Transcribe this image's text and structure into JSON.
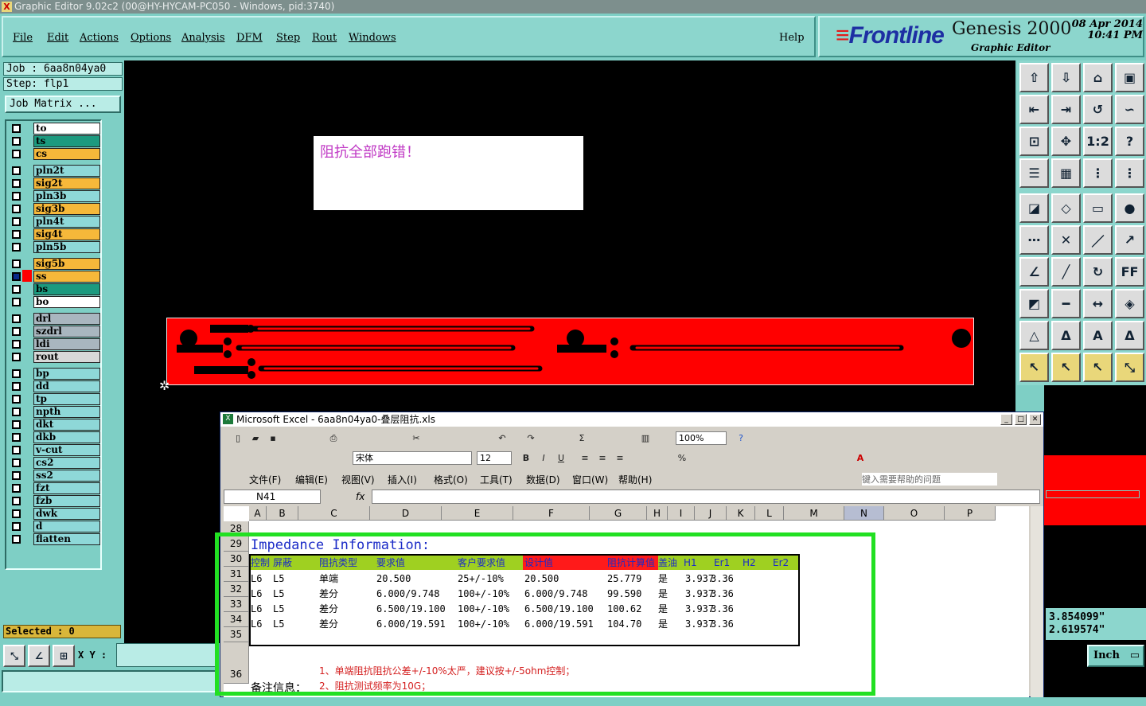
{
  "window": {
    "title": "Graphic Editor 9.02c2 (00@HY-HYCAM-PC050 - Windows, pid:3740)"
  },
  "menu": [
    "File",
    "Edit",
    "Actions",
    "Options",
    "Analysis",
    "DFM",
    "Step",
    "Rout",
    "Windows"
  ],
  "help": "Help",
  "brand": {
    "logo_prefix": "≡",
    "logo": "Frontline",
    "product": "Genesis 2000",
    "subtitle": "Graphic Editor",
    "date": "08 Apr 2014",
    "time": "10:41 PM"
  },
  "job": {
    "job": "Job : 6aa8n04ya0",
    "step": "Step: flp1",
    "matrix_button": "Job Matrix ..."
  },
  "layers": [
    {
      "name": "to",
      "color": "#ffffff"
    },
    {
      "name": "ts",
      "color": "#1c9a7f"
    },
    {
      "name": "cs",
      "color": "#f6b83a"
    },
    {
      "name": "pln2t",
      "color": "#8ed8d8"
    },
    {
      "name": "sig2t",
      "color": "#f6b83a"
    },
    {
      "name": "pln3b",
      "color": "#8ed8d8"
    },
    {
      "name": "sig3b",
      "color": "#f6b83a"
    },
    {
      "name": "pln4t",
      "color": "#8ed8d8"
    },
    {
      "name": "sig4t",
      "color": "#f6b83a"
    },
    {
      "name": "pln5b",
      "color": "#8ed8d8"
    },
    {
      "name": "sig5b",
      "color": "#f6b83a"
    },
    {
      "name": "ss",
      "color": "#f6b83a"
    },
    {
      "name": "bs",
      "color": "#1c9a7f"
    },
    {
      "name": "bo",
      "color": "#ffffff"
    },
    {
      "name": "drl",
      "color": "#a9b6bf"
    },
    {
      "name": "szdrl",
      "color": "#a9b6bf"
    },
    {
      "name": "ldi",
      "color": "#a9b6bf"
    },
    {
      "name": "rout",
      "color": "#d8d8d8"
    },
    {
      "name": "bp",
      "color": "#8ed8d8"
    },
    {
      "name": "dd",
      "color": "#8ed8d8"
    },
    {
      "name": "tp",
      "color": "#8ed8d8"
    },
    {
      "name": "npth",
      "color": "#8ed8d8"
    },
    {
      "name": "dkt",
      "color": "#8ed8d8"
    },
    {
      "name": "dkb",
      "color": "#8ed8d8"
    },
    {
      "name": "v-cut",
      "color": "#8ed8d8"
    },
    {
      "name": "cs2",
      "color": "#8ed8d8"
    },
    {
      "name": "ss2",
      "color": "#8ed8d8"
    },
    {
      "name": "fzt",
      "color": "#8ed8d8"
    },
    {
      "name": "fzb",
      "color": "#8ed8d8"
    },
    {
      "name": "dwk",
      "color": "#8ed8d8"
    },
    {
      "name": "d",
      "color": "#8ed8d8"
    },
    {
      "name": "flatten",
      "color": "#8ed8d8"
    }
  ],
  "selected": "Selected : 0",
  "xy_label": "X Y :",
  "note": "阻抗全部跑错！",
  "coords": {
    "x": "3.854099\"",
    "y": "2.619574\""
  },
  "unit": "Inch",
  "excel": {
    "title": "Microsoft Excel - 6aa8n04ya0-叠层阻抗.xls",
    "zoom": "100%",
    "font": "宋体",
    "font_size": "12",
    "menu": [
      "文件(F)",
      "编辑(E)",
      "视图(V)",
      "插入(I)",
      "格式(O)",
      "工具(T)",
      "数据(D)",
      "窗口(W)",
      "帮助(H)"
    ],
    "help_placeholder": "键入需要帮助的问题",
    "namebox": "N41",
    "fx": "fx",
    "columns": [
      "A",
      "B",
      "C",
      "D",
      "E",
      "F",
      "G",
      "H",
      "I",
      "J",
      "K",
      "L",
      "M",
      "N",
      "O",
      "P"
    ],
    "rows": [
      "28",
      "29",
      "30",
      "31",
      "32",
      "33",
      "34",
      "35",
      "36"
    ],
    "heading": "Impedance Information:",
    "header": [
      "控制",
      "屏蔽",
      "阻抗类型",
      "要求值",
      "客户要求值",
      "设计值",
      "阻抗计算值",
      "盖油",
      "H1",
      "Er1",
      "H2",
      "Er2"
    ],
    "data": [
      [
        "L6",
        "L5",
        "单端",
        "20.500",
        "25+/-10%",
        "20.500",
        "25.779",
        "是",
        "3.937",
        "3.36"
      ],
      [
        "L6",
        "L5",
        "差分",
        "6.000/9.748",
        "100+/-10%",
        "6.000/9.748",
        "99.590",
        "是",
        "3.937",
        "3.36"
      ],
      [
        "L6",
        "L5",
        "差分",
        "6.500/19.100",
        "100+/-10%",
        "6.500/19.100",
        "100.62",
        "是",
        "3.937",
        "3.36"
      ],
      [
        "L6",
        "L5",
        "差分",
        "6.000/19.591",
        "100+/-10%",
        "6.000/19.591",
        "104.70",
        "是",
        "3.937",
        "3.36"
      ]
    ],
    "remark_label": "备注信息：",
    "remark1": "1、单端阻抗阻抗公差+/-10%太严，建议按+/-5ohm控制；",
    "remark2": "2、阻抗测试频率为10G；"
  }
}
